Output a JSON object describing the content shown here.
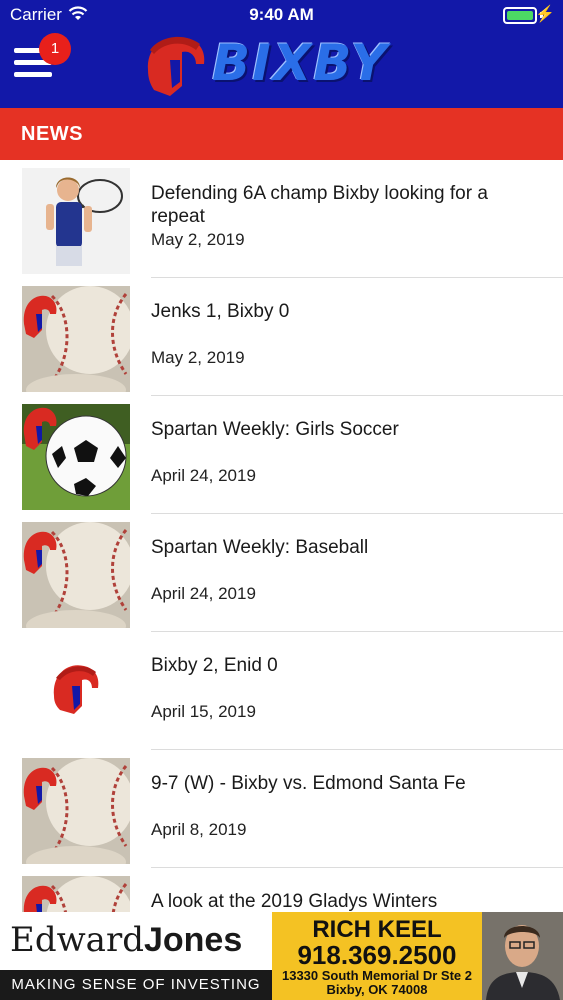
{
  "status_bar": {
    "carrier": "Carrier",
    "time": "9:40 AM"
  },
  "header": {
    "logo_text": "BIXBY",
    "menu_badge_count": "1",
    "brand_colors": {
      "header": "#1218a8",
      "section": "#e53224"
    }
  },
  "section": {
    "title": "NEWS"
  },
  "news": [
    {
      "headline": "Defending 6A champ Bixby looking for a repeat",
      "date": "May 2, 2019",
      "thumb": "tennis-player"
    },
    {
      "headline": "Jenks 1, Bixby 0",
      "date": "May 2, 2019",
      "thumb": "baseball-logo"
    },
    {
      "headline": "Spartan Weekly: Girls Soccer",
      "date": "April 24, 2019",
      "thumb": "soccer-ball-logo"
    },
    {
      "headline": "Spartan Weekly: Baseball",
      "date": "April 24, 2019",
      "thumb": "baseball-logo"
    },
    {
      "headline": "Bixby 2, Enid 0",
      "date": "April 15, 2019",
      "thumb": "spartan-helmet"
    },
    {
      "headline": "9-7 (W) - Bixby vs. Edmond Santa Fe",
      "date": "April 8, 2019",
      "thumb": "baseball-logo"
    },
    {
      "headline": "A look at the 2019 Gladys Winters",
      "date": "",
      "thumb": "baseball-logo"
    }
  ],
  "ad": {
    "brand_regular": "Edward",
    "brand_bold": "Jones",
    "tagline": "MAKING SENSE OF INVESTING",
    "agent_name": "RICH KEEL",
    "phone": "918.369.2500",
    "address_line1": "13330 South Memorial Dr Ste 2",
    "address_line2": "Bixby, OK 74008"
  }
}
